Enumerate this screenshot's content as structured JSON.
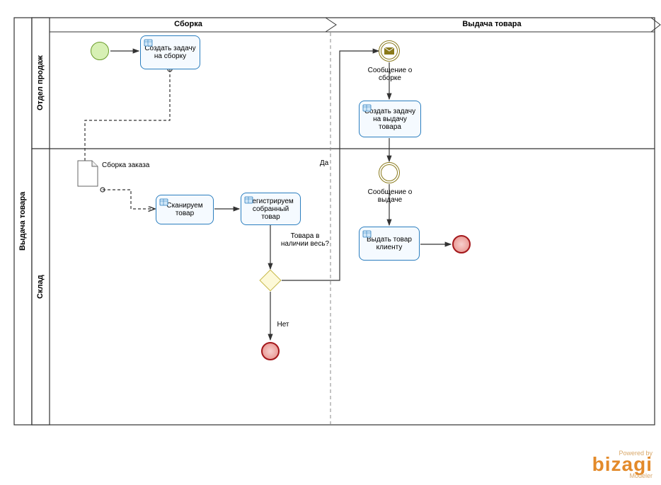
{
  "pool": {
    "title": "Выдача товара"
  },
  "lanes": {
    "top": "Отдел продаж",
    "bottom": "Склад"
  },
  "phases": {
    "left": "Сборка",
    "right": "Выдача товара"
  },
  "tasks": {
    "create_assembly": "Создать задачу на сборку",
    "scan_goods": "Сканируем товар",
    "register_goods": "Регистрируем собранный товар",
    "create_issue": "Создать задачу на выдачу товара",
    "issue_client": "Выдать товар клиенту"
  },
  "events": {
    "msg_assembly": "Сообщение о сборке",
    "msg_issue": "Сообщение о выдаче"
  },
  "gateway": {
    "question": "Товара в наличии весь?",
    "yes": "Да",
    "no": "Нет"
  },
  "doc": {
    "assembly_order": "Сборка заказа"
  },
  "watermark": {
    "powered": "Powered by",
    "brand": "bizagi",
    "modeler": "Modeler"
  }
}
